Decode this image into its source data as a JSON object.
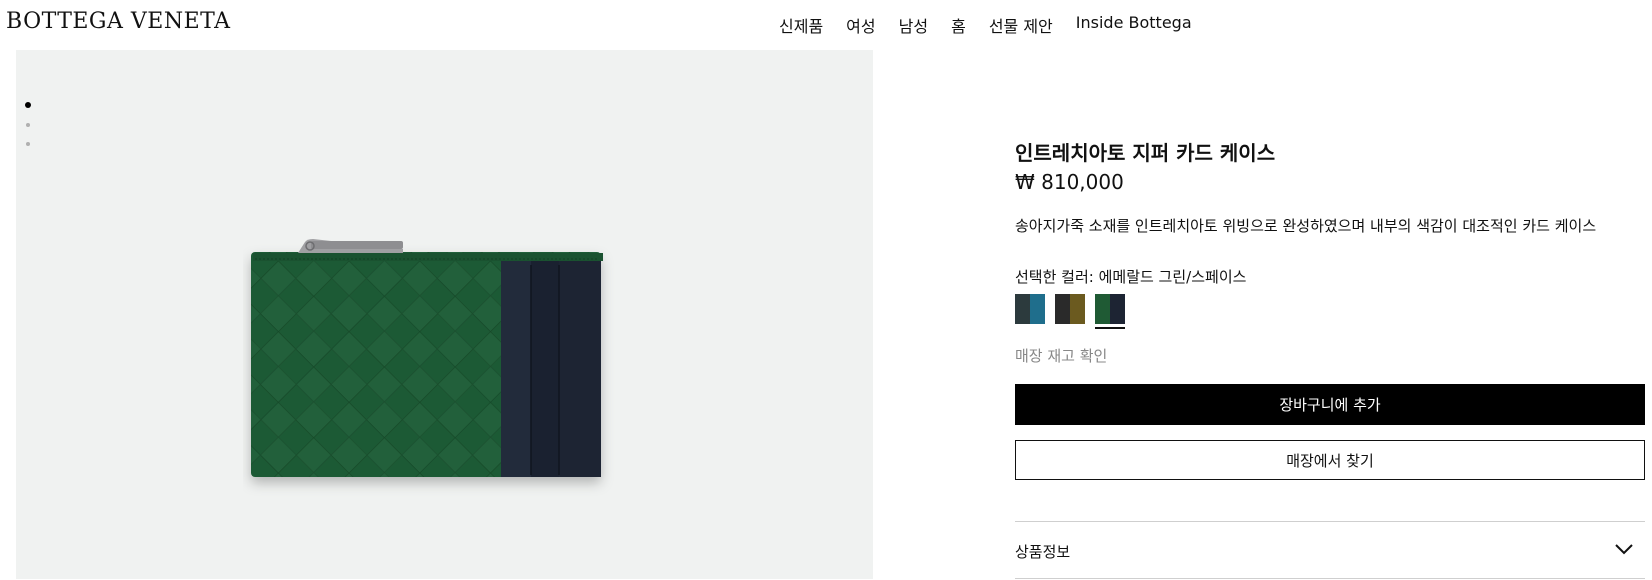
{
  "brand": {
    "logo": "BOTTEGA VENETA"
  },
  "nav": {
    "items": [
      {
        "label": "신제품"
      },
      {
        "label": "여성"
      },
      {
        "label": "남성"
      },
      {
        "label": "홈"
      },
      {
        "label": "선물 제안"
      },
      {
        "label": "Inside Bottega"
      }
    ]
  },
  "gallery": {
    "image_count": 3,
    "active_index": 1,
    "product_colors": {
      "leather": "#1f5a34",
      "pocket": "#1d2433",
      "zipper": "#9a9a9c"
    }
  },
  "product": {
    "title": "인트레치아토 지퍼 카드 케이스",
    "price": "₩ 810,000",
    "description": "송아지가죽 소재를 인트레치아토 위빙으로 완성하였으며 내부의 색감이 대조적인 카드 케이스",
    "color_label": "선택한 컬러: 에메랄드 그린/스페이스",
    "swatches": [
      {
        "primary": "#2c3a3d",
        "accent": "#1f6e8c",
        "selected": false
      },
      {
        "primary": "#2a2a2a",
        "accent": "#6b5a1f",
        "selected": false
      },
      {
        "primary": "#1f5a34",
        "accent": "#1d2433",
        "selected": true
      }
    ],
    "stock_check": "매장 재고 확인",
    "add_to_cart": "장바구니에 추가",
    "find_in_store": "매장에서 찾기",
    "accordion_label": "상품정보"
  }
}
